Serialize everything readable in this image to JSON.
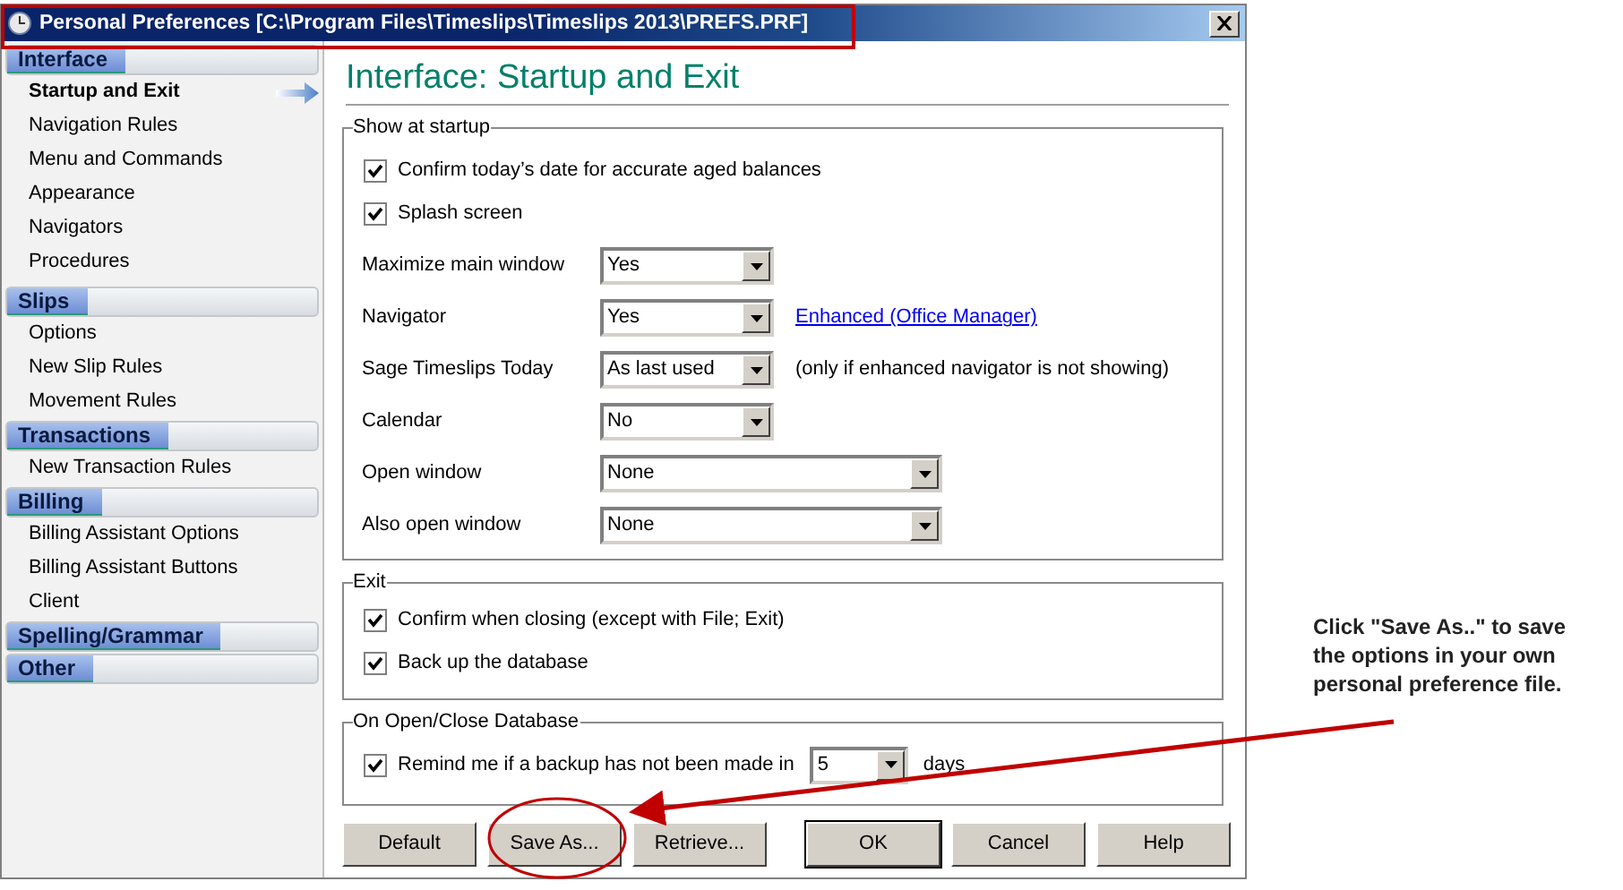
{
  "window": {
    "title": "Personal Preferences [C:\\Program Files\\Timeslips\\Timeslips 2013\\PREFS.PRF]"
  },
  "sidebar": {
    "sections": [
      {
        "title": "Interface",
        "items": [
          {
            "label": "Startup and Exit",
            "selected": true
          },
          {
            "label": "Navigation Rules",
            "selected": false
          },
          {
            "label": "Menu and Commands",
            "selected": false
          },
          {
            "label": "Appearance",
            "selected": false
          },
          {
            "label": "Navigators",
            "selected": false
          },
          {
            "label": "Procedures",
            "selected": false
          }
        ]
      },
      {
        "title": "Slips",
        "items": [
          {
            "label": "Options",
            "selected": false
          },
          {
            "label": "New Slip Rules",
            "selected": false
          },
          {
            "label": "Movement Rules",
            "selected": false
          }
        ]
      },
      {
        "title": "Transactions",
        "items": [
          {
            "label": "New Transaction Rules",
            "selected": false
          }
        ]
      },
      {
        "title": "Billing",
        "items": [
          {
            "label": "Billing Assistant Options",
            "selected": false
          },
          {
            "label": "Billing Assistant Buttons",
            "selected": false
          },
          {
            "label": "Client",
            "selected": false
          }
        ]
      },
      {
        "title": "Spelling/Grammar"
      },
      {
        "title": "Other"
      }
    ]
  },
  "heading": "Interface: Startup and Exit",
  "groups": [
    {
      "title": "Show at startup",
      "rows": [
        {
          "kind": "checkbox",
          "label": "Confirm today’s date for accurate aged balances",
          "checked": true
        },
        {
          "kind": "checkbox",
          "label": "Splash screen",
          "checked": true
        },
        {
          "kind": "dropdown",
          "label": "Maximize main window",
          "value": "Yes"
        },
        {
          "kind": "dropdown",
          "label": "Navigator",
          "value": "Yes",
          "link": "Enhanced (Office Manager)"
        },
        {
          "kind": "dropdown",
          "label": "Sage Timeslips Today",
          "value": "As last used",
          "note": "(only if enhanced navigator is not showing)"
        },
        {
          "kind": "dropdown",
          "label": "Calendar",
          "value": "No"
        },
        {
          "kind": "wide_dropdown",
          "label": "Open window",
          "value": "None"
        },
        {
          "kind": "wide_dropdown",
          "label": "Also open window",
          "value": "None"
        }
      ]
    },
    {
      "title": "Exit",
      "rows": [
        {
          "kind": "checkbox",
          "label": "Confirm when closing (except with File; Exit)",
          "checked": true
        },
        {
          "kind": "checkbox",
          "label": "Back up the database",
          "checked": true
        }
      ]
    },
    {
      "title": "On Open/Close Database",
      "rows": [
        {
          "kind": "checkbox_dropdown",
          "label": "Remind me if a backup has not been made in",
          "checked": true,
          "value": "5",
          "suffix": "days"
        }
      ]
    }
  ],
  "buttons": [
    {
      "label": "Default"
    },
    {
      "label": "Save As..."
    },
    {
      "label": "Retrieve..."
    },
    {
      "label": "OK"
    },
    {
      "label": "Cancel"
    },
    {
      "label": "Help"
    }
  ],
  "callout": "Click \"Save As..\" to save the options in your own personal preference file."
}
